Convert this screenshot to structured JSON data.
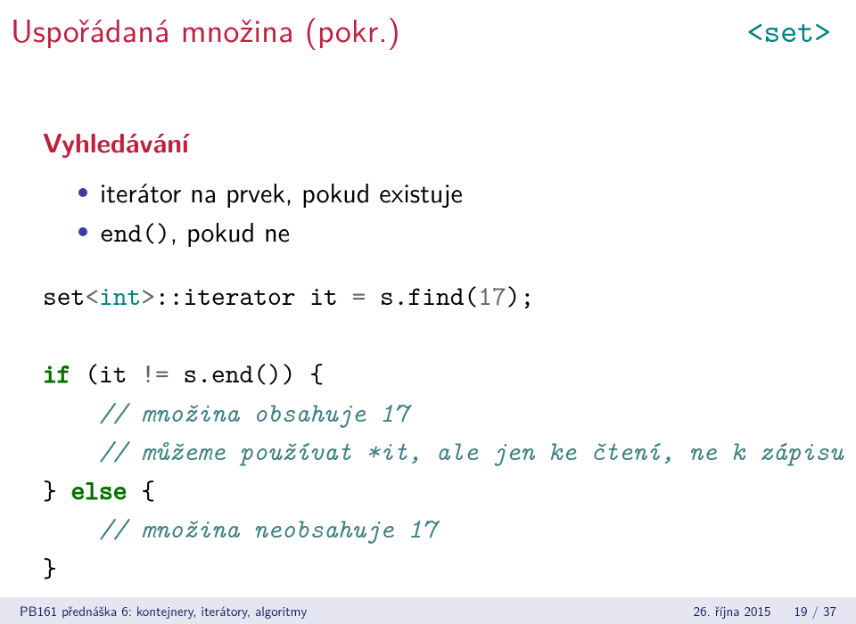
{
  "header": {
    "title": "Uspořádaná množina (pokr.)",
    "tag": "<set>"
  },
  "subheading": "Vyhledávání",
  "bullets": [
    {
      "text": "iterátor na prvek, pokud existuje"
    },
    {
      "prefix_code": "end()",
      "suffix_text": ", pokud ne"
    }
  ],
  "code": {
    "l1_a": "set",
    "l1_b": "<",
    "l1_c": "int",
    "l1_d": ">",
    "l1_e": "::iterator it ",
    "l1_f": "=",
    "l1_g": " s.find(",
    "l1_h": "17",
    "l1_i": ");",
    "l2": "",
    "l3_a": "if",
    "l3_b": " (it ",
    "l3_c": "!=",
    "l3_d": " s.end()) {",
    "l4": "    // množina obsahuje 17",
    "l5": "    // můžeme používat *it, ale jen ke čtení, ne k zápisu",
    "l6_a": "} ",
    "l6_b": "else",
    "l6_c": " {",
    "l7": "    // množina neobsahuje 17",
    "l8": "}"
  },
  "footer": {
    "left": "PB161 přednáška 6: kontejnery, iterátory, algoritmy",
    "date": "26. října 2015",
    "page": "19 / 37"
  }
}
